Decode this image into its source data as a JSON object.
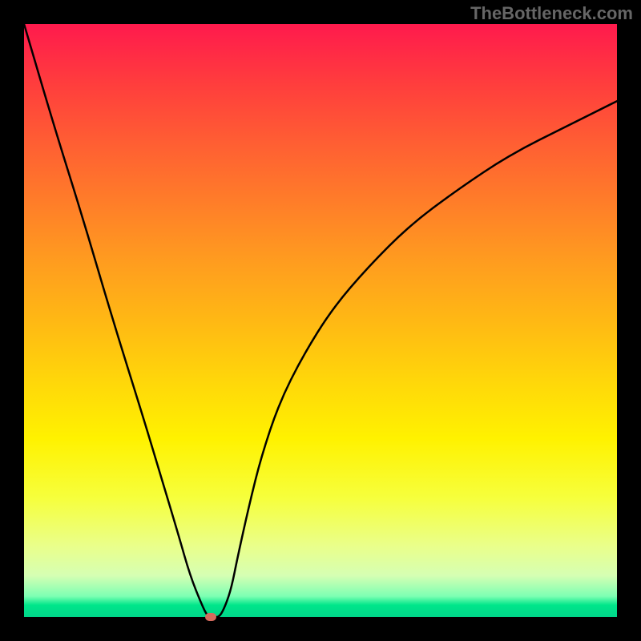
{
  "watermark": "TheBottleneck.com",
  "chart_data": {
    "type": "line",
    "title": "",
    "xlabel": "",
    "ylabel": "",
    "xlim": [
      0,
      100
    ],
    "ylim": [
      0,
      100
    ],
    "x": [
      0,
      5,
      10,
      15,
      20,
      23,
      26,
      28,
      30,
      31,
      32,
      33,
      34,
      35,
      36,
      38,
      40,
      43,
      47,
      52,
      58,
      65,
      73,
      82,
      92,
      100
    ],
    "y": [
      100,
      83,
      67,
      50,
      34,
      24,
      14,
      7,
      2,
      0,
      0,
      0,
      2,
      5,
      10,
      19,
      27,
      36,
      44,
      52,
      59,
      66,
      72,
      78,
      83,
      87
    ],
    "marker": {
      "x": 31.5,
      "y": 0
    },
    "background_gradient": {
      "stops": [
        {
          "pos": 0,
          "color": "#ff1a4d"
        },
        {
          "pos": 50,
          "color": "#ffb814"
        },
        {
          "pos": 80,
          "color": "#f6ff3d"
        },
        {
          "pos": 100,
          "color": "#00d68a"
        }
      ]
    }
  }
}
